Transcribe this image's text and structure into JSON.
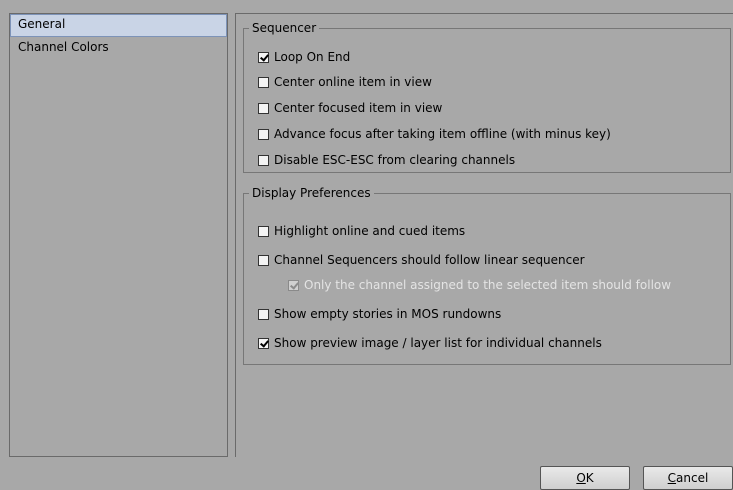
{
  "nav": {
    "items": [
      {
        "label": "General",
        "selected": true
      },
      {
        "label": "Channel Colors",
        "selected": false
      }
    ]
  },
  "sequencer": {
    "title": "Sequencer",
    "options": [
      {
        "label": "Loop On End",
        "checked": true
      },
      {
        "label": "Center online item in view",
        "checked": false
      },
      {
        "label": "Center focused item in view",
        "checked": false
      },
      {
        "label": "Advance focus after taking item offline (with minus key)",
        "checked": false
      },
      {
        "label": "Disable ESC-ESC from clearing channels",
        "checked": false
      }
    ]
  },
  "display": {
    "title": "Display Preferences",
    "options": [
      {
        "label": "Highlight online and cued items",
        "checked": false
      },
      {
        "label": "Channel Sequencers should follow linear sequencer",
        "checked": false
      },
      {
        "label": "Only the channel assigned to the selected item should follow",
        "checked": true,
        "disabled": true
      },
      {
        "label": "Show empty stories in MOS rundowns",
        "checked": false
      },
      {
        "label": "Show preview image / layer list for individual channels",
        "checked": true
      }
    ]
  },
  "buttons": {
    "ok": {
      "mnemonic": "O",
      "rest": "K"
    },
    "cancel": {
      "mnemonic": "C",
      "rest": "ancel"
    }
  }
}
